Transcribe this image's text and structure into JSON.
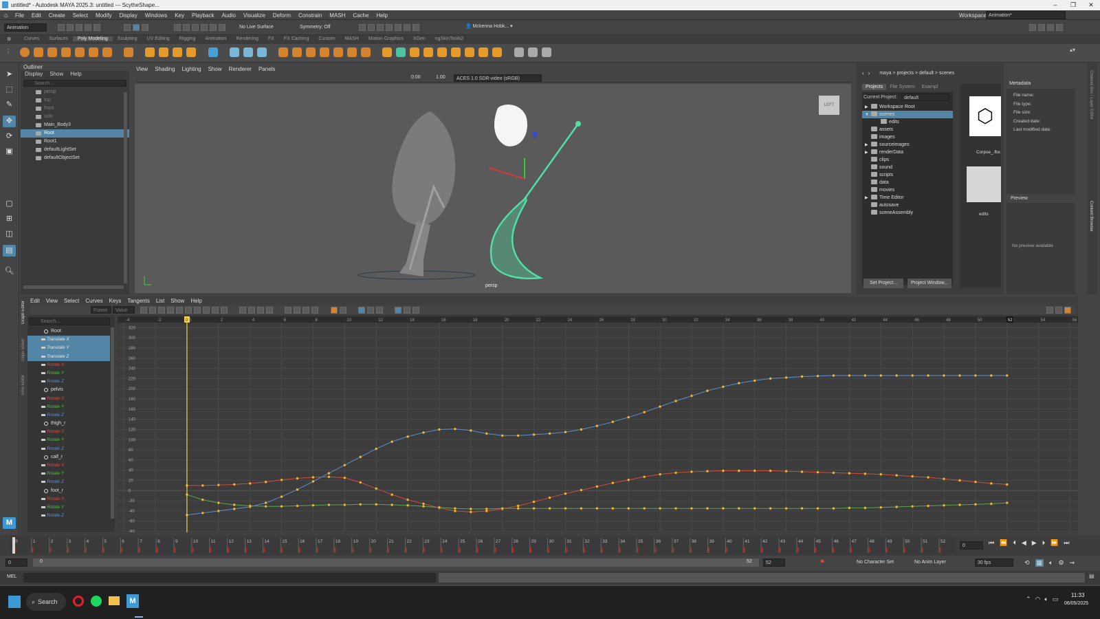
{
  "window": {
    "title": "untitled* - Autodesk MAYA 2025.3: untitled  ---  ScytheShape...",
    "controls": [
      "–",
      "❐",
      "✕"
    ]
  },
  "menubar": {
    "items": [
      "File",
      "Edit",
      "Create",
      "Select",
      "Modify",
      "Display",
      "Windows",
      "Key",
      "Playback",
      "Audio",
      "Visualize",
      "Deform",
      "Constrain",
      "MASH",
      "Cache",
      "Help"
    ],
    "workspace_label": "Workspace:",
    "workspace_value": "Animation*"
  },
  "statusline": {
    "mode": "Animation",
    "live_surface": "No Live Surface",
    "symmetry": "Symmetry: Off",
    "user": "Mckenna Hobk..."
  },
  "shelf": {
    "tabs": [
      "Curves",
      "Surfaces",
      "Poly Modeling",
      "Sculpting",
      "UV Editing",
      "Rigging",
      "Animation",
      "Rendering",
      "FX",
      "FX Caching",
      "Custom",
      "MASH",
      "Motion Graphics",
      "XGen",
      "ngSkinTools2"
    ],
    "active_tab": "Poly Modeling"
  },
  "outliner": {
    "title": "Outliner",
    "menus": [
      "Display",
      "Show",
      "Help"
    ],
    "search_placeholder": "Search...",
    "items": [
      {
        "label": "persp",
        "dim": true
      },
      {
        "label": "top",
        "dim": true
      },
      {
        "label": "front",
        "dim": true
      },
      {
        "label": "side",
        "dim": true
      },
      {
        "label": "Main_Body3",
        "dim": false
      },
      {
        "label": "Root",
        "dim": false,
        "selected": true
      },
      {
        "label": "Root1",
        "dim": false
      },
      {
        "label": "defaultLightSet",
        "dim": false
      },
      {
        "label": "defaultObjectSet",
        "dim": false
      }
    ]
  },
  "viewport": {
    "menus": [
      "View",
      "Shading",
      "Lighting",
      "Show",
      "Renderer",
      "Panels"
    ],
    "camera_label": "persp",
    "view_cube": "LEFT",
    "exposure": "0.00",
    "gamma": "1.00",
    "color_space": "ACES 1.0 SDR-video (sRGB)"
  },
  "content_browser": {
    "breadcrumb": [
      "maya",
      "projects",
      "default",
      "scenes"
    ],
    "tabs": [
      "Projects",
      "File System",
      "Exampl"
    ],
    "current_project_label": "Current Project:",
    "current_project": "default",
    "tree": [
      {
        "label": "Workspace Root",
        "indent": 0,
        "arrow": "▶"
      },
      {
        "label": "scenes",
        "indent": 0,
        "arrow": "▼",
        "selected": true
      },
      {
        "label": "edits",
        "indent": 1,
        "arrow": ""
      },
      {
        "label": "assets",
        "indent": 0,
        "arrow": ""
      },
      {
        "label": "images",
        "indent": 0,
        "arrow": ""
      },
      {
        "label": "sourceimages",
        "indent": 0,
        "arrow": "▶"
      },
      {
        "label": "renderData",
        "indent": 0,
        "arrow": "▶"
      },
      {
        "label": "clips",
        "indent": 0,
        "arrow": ""
      },
      {
        "label": "sound",
        "indent": 0,
        "arrow": ""
      },
      {
        "label": "scripts",
        "indent": 0,
        "arrow": ""
      },
      {
        "label": "data",
        "indent": 0,
        "arrow": ""
      },
      {
        "label": "movies",
        "indent": 0,
        "arrow": ""
      },
      {
        "label": "Time Editor",
        "indent": 0,
        "arrow": "▶"
      },
      {
        "label": "autosave",
        "indent": 0,
        "arrow": ""
      },
      {
        "label": "sceneAssembly",
        "indent": 0,
        "arrow": ""
      }
    ],
    "set_project": "Set Project...",
    "project_window": "Project Window...",
    "file_thumb": "Corpse_.fbx",
    "folder_thumb": "edits"
  },
  "metadata": {
    "title": "Metadata",
    "fields": [
      "File name:",
      "File type:",
      "File size:",
      "Created date:",
      "Last modified date:"
    ],
    "preview_title": "Preview",
    "preview_empty": "No preview available"
  },
  "side_tabs": [
    "Channel Box / Layer Editor",
    "Content Browser"
  ],
  "graph_editor": {
    "menus": [
      "Edit",
      "View",
      "Select",
      "Curves",
      "Keys",
      "Tangents",
      "List",
      "Show",
      "Help"
    ],
    "frame_label": "Frame",
    "value_label": "Value",
    "search_placeholder": "Search...",
    "side_tabs": [
      "Graph Editor",
      "Dope Sheet",
      "Time Editor"
    ],
    "channels": [
      {
        "label": "Root",
        "type": "node"
      },
      {
        "label": "Translate X",
        "type": "tx",
        "sel": true
      },
      {
        "label": "Translate Y",
        "type": "ty",
        "sel": true
      },
      {
        "label": "Translate Z",
        "type": "tz",
        "sel": true
      },
      {
        "label": "Rotate X",
        "type": "rx"
      },
      {
        "label": "Rotate Y",
        "type": "ry"
      },
      {
        "label": "Rotate Z",
        "type": "rz"
      },
      {
        "label": "pelvis",
        "type": "node"
      },
      {
        "label": "Rotate X",
        "type": "rx"
      },
      {
        "label": "Rotate Y",
        "type": "ry"
      },
      {
        "label": "Rotate Z",
        "type": "rz"
      },
      {
        "label": "thigh_r",
        "type": "node"
      },
      {
        "label": "Rotate X",
        "type": "rx"
      },
      {
        "label": "Rotate Y",
        "type": "ry"
      },
      {
        "label": "Rotate Z",
        "type": "rz"
      },
      {
        "label": "calf_r",
        "type": "node"
      },
      {
        "label": "Rotate X",
        "type": "rx"
      },
      {
        "label": "Rotate Y",
        "type": "ry"
      },
      {
        "label": "Rotate Z",
        "type": "rz"
      },
      {
        "label": "foot_r",
        "type": "node"
      },
      {
        "label": "Rotate X",
        "type": "rx"
      },
      {
        "label": "Rotate Y",
        "type": "ry"
      },
      {
        "label": "Rotate Z",
        "type": "rz"
      }
    ],
    "x_ticks": [
      "-4",
      "-2",
      "0",
      "2",
      "4",
      "6",
      "8",
      "10",
      "12",
      "14",
      "16",
      "18",
      "20",
      "22",
      "24",
      "26",
      "28",
      "30",
      "32",
      "34",
      "36",
      "38",
      "40",
      "42",
      "44",
      "46",
      "48",
      "50",
      "52",
      "54",
      "56"
    ],
    "y_ticks": [
      "320",
      "300",
      "280",
      "260",
      "240",
      "220",
      "200",
      "180",
      "160",
      "140",
      "120",
      "100",
      "80",
      "60",
      "40",
      "20",
      "0",
      "-20",
      "-40",
      "-60",
      "-80"
    ],
    "current_frame": "0",
    "end_frame_marker": "52"
  },
  "chart_data": {
    "type": "line",
    "x_range": [
      -4,
      57
    ],
    "y_range": [
      -80,
      320
    ],
    "current_frame": 0,
    "series": [
      {
        "color": "#5a8fd6",
        "x": [
          0,
          1,
          2,
          3,
          4,
          5,
          6,
          7,
          8,
          9,
          10,
          11,
          12,
          13,
          14,
          15,
          16,
          17,
          18,
          19,
          20,
          21,
          22,
          23,
          24,
          25,
          26,
          27,
          28,
          29,
          30,
          31,
          32,
          33,
          34,
          35,
          36,
          37,
          38,
          39,
          40,
          41,
          42,
          43,
          44,
          45,
          46,
          47,
          48,
          49,
          50,
          51,
          52
        ],
        "y": [
          -48,
          -44,
          -40,
          -36,
          -32,
          -24,
          -12,
          2,
          18,
          34,
          50,
          66,
          82,
          96,
          106,
          114,
          120,
          121,
          118,
          112,
          108,
          108,
          110,
          112,
          115,
          120,
          127,
          135,
          144,
          154,
          165,
          176,
          186,
          196,
          204,
          211,
          216,
          220,
          222,
          224,
          225,
          226,
          226,
          226,
          226,
          226,
          226,
          226,
          226,
          226,
          226,
          226,
          226
        ]
      },
      {
        "color": "#d64a3a",
        "x": [
          0,
          1,
          2,
          3,
          4,
          5,
          6,
          7,
          8,
          9,
          10,
          11,
          12,
          13,
          14,
          15,
          16,
          17,
          18,
          19,
          20,
          21,
          22,
          23,
          24,
          25,
          26,
          27,
          28,
          29,
          30,
          31,
          32,
          33,
          34,
          35,
          36,
          37,
          38,
          39,
          40,
          41,
          42,
          43,
          44,
          45,
          46,
          47,
          48,
          49,
          50,
          51,
          52
        ],
        "y": [
          10,
          10,
          11,
          12,
          14,
          17,
          21,
          24,
          26,
          27,
          25,
          16,
          4,
          -8,
          -18,
          -26,
          -34,
          -40,
          -42,
          -40,
          -36,
          -30,
          -22,
          -14,
          -6,
          1,
          8,
          15,
          21,
          27,
          32,
          35,
          37,
          38,
          39,
          39,
          39,
          39,
          38,
          37,
          36,
          35,
          34,
          33,
          32,
          30,
          28,
          26,
          23,
          20,
          17,
          14,
          12
        ]
      },
      {
        "color": "#5aa84a",
        "x": [
          0,
          1,
          2,
          3,
          4,
          5,
          6,
          7,
          8,
          9,
          10,
          11,
          12,
          13,
          14,
          15,
          16,
          17,
          18,
          19,
          20,
          21,
          22,
          23,
          24,
          25,
          26,
          27,
          28,
          29,
          30,
          31,
          32,
          33,
          34,
          35,
          36,
          37,
          38,
          39,
          40,
          41,
          42,
          43,
          44,
          45,
          46,
          47,
          48,
          49,
          50,
          51,
          52
        ],
        "y": [
          -8,
          -18,
          -24,
          -28,
          -30,
          -31,
          -31,
          -30,
          -29,
          -28,
          -28,
          -27,
          -27,
          -28,
          -29,
          -31,
          -33,
          -35,
          -36,
          -36,
          -35,
          -35,
          -35,
          -35,
          -35,
          -35,
          -35,
          -35,
          -35,
          -35,
          -35,
          -35,
          -35,
          -35,
          -35,
          -35,
          -35,
          -35,
          -35,
          -35,
          -35,
          -35,
          -34,
          -34,
          -33,
          -32,
          -31,
          -30,
          -29,
          -28,
          -27,
          -26,
          -24
        ]
      }
    ]
  },
  "timeslider": {
    "ticks": [
      "0",
      "1",
      "2",
      "3",
      "4",
      "5",
      "6",
      "7",
      "8",
      "9",
      "10",
      "11",
      "12",
      "13",
      "14",
      "15",
      "16",
      "17",
      "18",
      "19",
      "20",
      "21",
      "22",
      "23",
      "24",
      "25",
      "26",
      "27",
      "28",
      "29",
      "30",
      "31",
      "32",
      "33",
      "34",
      "35",
      "36",
      "37",
      "38",
      "39",
      "40",
      "41",
      "42",
      "43",
      "44",
      "45",
      "46",
      "47",
      "48",
      "49",
      "50",
      "51",
      "52"
    ],
    "current_frame_field": "0"
  },
  "range": {
    "start": "0",
    "inner_start": "0",
    "inner_end": "52",
    "end": "52",
    "character_set": "No Character Set",
    "anim_layer": "No Anim Layer",
    "fps": "30 fps"
  },
  "mel": {
    "label": "MEL"
  },
  "taskbar": {
    "search": "Search",
    "time": "11:33",
    "date": "06/05/2025"
  }
}
